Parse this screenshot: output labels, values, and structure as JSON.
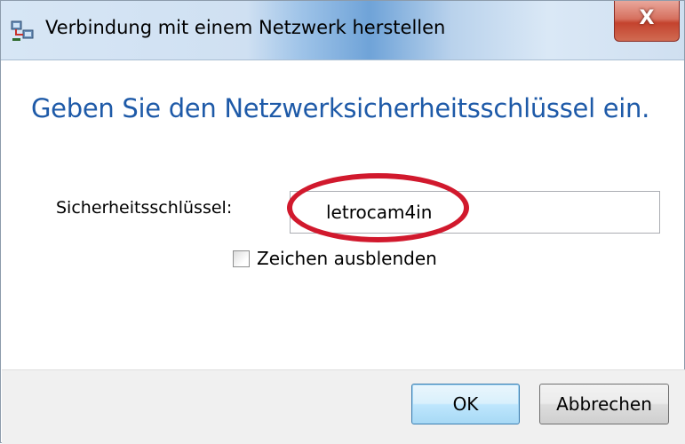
{
  "window": {
    "title": "Verbindung mit einem Netzwerk herstellen",
    "close_label": "X",
    "icon": "network-icon"
  },
  "main": {
    "heading": "Geben Sie den Netzwerksicherheitsschlüssel ein.",
    "security_key_label": "Sicherheitsschlüssel:",
    "security_key_value": "letrocam4in",
    "hide_characters_label": "Zeichen ausblenden",
    "hide_characters_checked": false,
    "annotation_color": "#d1192d"
  },
  "footer": {
    "ok_label": "OK",
    "cancel_label": "Abbrechen"
  },
  "colors": {
    "heading": "#1e5aa8",
    "close_button": "#c4432e"
  }
}
